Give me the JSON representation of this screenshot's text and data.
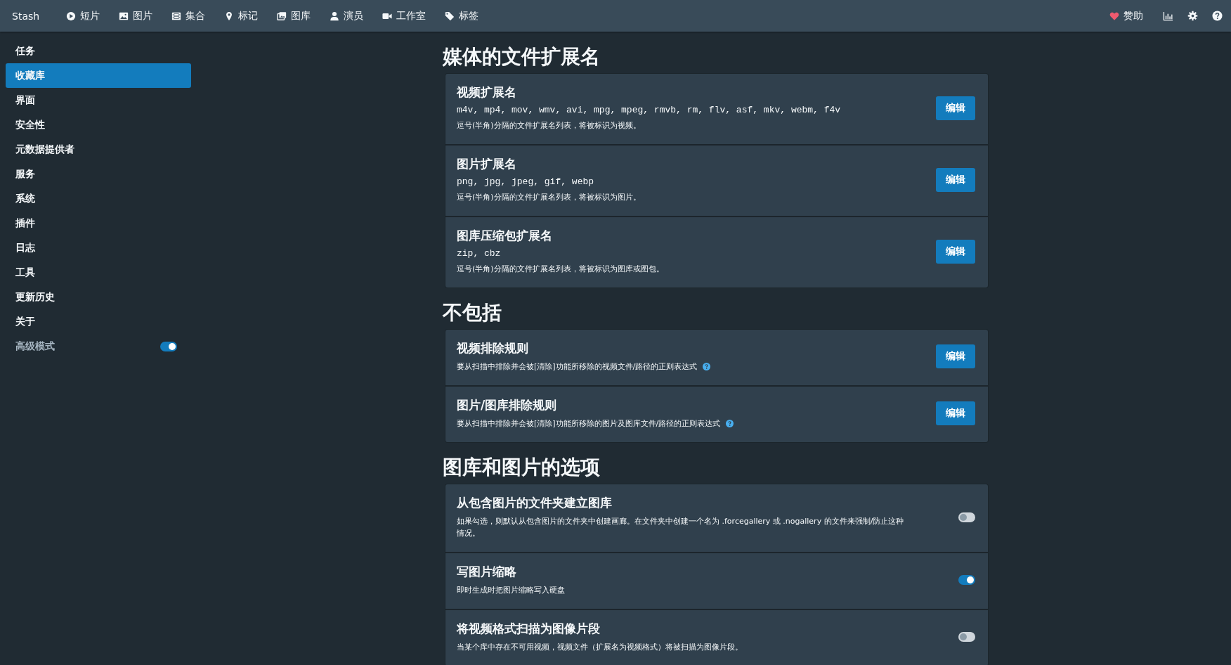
{
  "navbar": {
    "brand": "Stash",
    "items": [
      {
        "label": "短片"
      },
      {
        "label": "图片"
      },
      {
        "label": "集合"
      },
      {
        "label": "标记"
      },
      {
        "label": "图库"
      },
      {
        "label": "演员"
      },
      {
        "label": "工作室"
      },
      {
        "label": "标签"
      }
    ],
    "donate": "赞助"
  },
  "sidebar": {
    "items": [
      {
        "label": "任务",
        "selected": false
      },
      {
        "label": "收藏库",
        "selected": true
      },
      {
        "label": "界面",
        "selected": false
      },
      {
        "label": "安全性",
        "selected": false
      },
      {
        "label": "元数据提供者",
        "selected": false
      },
      {
        "label": "服务",
        "selected": false
      },
      {
        "label": "系统",
        "selected": false
      },
      {
        "label": "插件",
        "selected": false
      },
      {
        "label": "日志",
        "selected": false
      },
      {
        "label": "工具",
        "selected": false
      },
      {
        "label": "更新历史",
        "selected": false
      },
      {
        "label": "关于",
        "selected": false
      }
    ],
    "advanced_mode": {
      "label": "高级模式",
      "on": true
    }
  },
  "sections": [
    {
      "title": "媒体的文件扩展名",
      "rows": [
        {
          "kind": "edit",
          "title": "视频扩展名",
          "value": "m4v, mp4, mov, wmv, avi, mpg, mpeg, rmvb, rm, flv, asf, mkv, webm, f4v",
          "description": "逗号(半角)分隔的文件扩展名列表，将被标识为视频。",
          "help": false,
          "button": "编辑"
        },
        {
          "kind": "edit",
          "title": "图片扩展名",
          "value": "png, jpg, jpeg, gif, webp",
          "description": "逗号(半角)分隔的文件扩展名列表，将被标识为图片。",
          "help": false,
          "button": "编辑"
        },
        {
          "kind": "edit",
          "title": "图库压缩包扩展名",
          "value": "zip, cbz",
          "description": "逗号(半角)分隔的文件扩展名列表，将被标识为图库或图包。",
          "help": false,
          "button": "编辑"
        }
      ]
    },
    {
      "title": "不包括",
      "rows": [
        {
          "kind": "edit",
          "title": "视频排除规则",
          "description": "要从扫描中排除并会被[清除]功能所移除的视频文件/路径的正则表达式",
          "help": true,
          "button": "编辑"
        },
        {
          "kind": "edit",
          "title": "图片/图库排除规则",
          "description": "要从扫描中排除并会被[清除]功能所移除的图片及图库文件/路径的正则表达式",
          "help": true,
          "button": "编辑"
        }
      ]
    },
    {
      "title": "图库和图片的选项",
      "rows": [
        {
          "kind": "toggle",
          "title": "从包含图片的文件夹建立图库",
          "description": "如果勾选，则默认从包含图片的文件夹中创建画廊。在文件夹中创建一个名为 .forcegallery 或 .nogallery 的文件来强制/防止这种情况。",
          "on": false
        },
        {
          "kind": "toggle",
          "title": "写图片缩略",
          "description": "即时生成时把图片缩略写入硬盘",
          "on": true
        },
        {
          "kind": "toggle",
          "title": "将视频格式扫描为图像片段",
          "description": "当某个库中存在不可用视频，视频文件（扩展名为视频格式）将被扫描为图像片段。",
          "on": false
        }
      ]
    }
  ]
}
